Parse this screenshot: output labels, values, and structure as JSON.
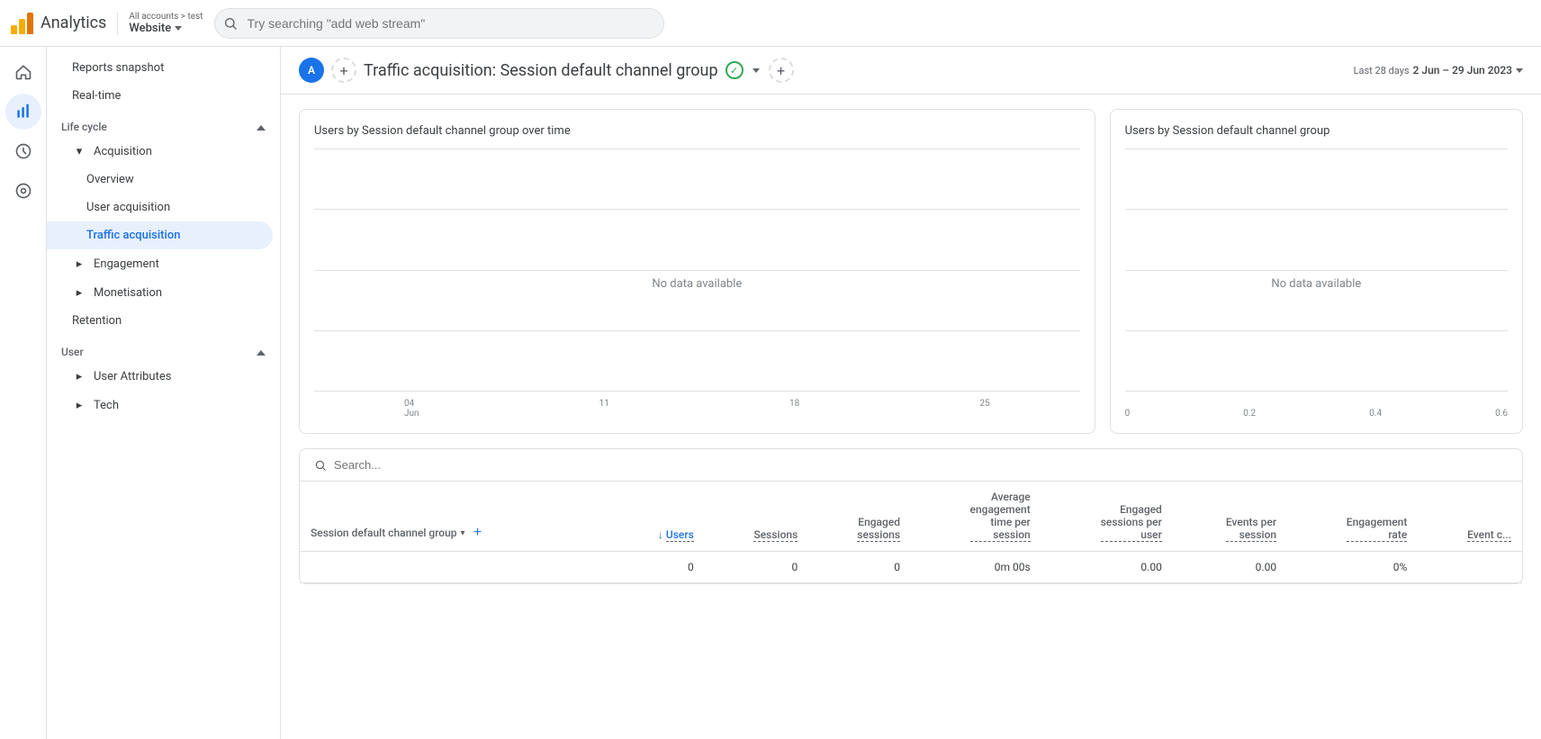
{
  "topbar": {
    "logo_alt": "Google Analytics logo",
    "app_title": "Analytics",
    "account_breadcrumb": "All accounts > test",
    "account_name": "Website",
    "search_placeholder": "Try searching \"add web stream\""
  },
  "left_nav": {
    "items": [
      {
        "id": "home",
        "icon": "house",
        "label": "Home"
      },
      {
        "id": "reports",
        "icon": "bar-chart",
        "label": "Reports",
        "active": true
      },
      {
        "id": "explore",
        "icon": "explore",
        "label": "Explore"
      },
      {
        "id": "advertising",
        "icon": "ads",
        "label": "Advertising"
      }
    ]
  },
  "sidebar": {
    "top_items": [
      {
        "id": "reports-snapshot",
        "label": "Reports snapshot",
        "indent": 0
      },
      {
        "id": "real-time",
        "label": "Real-time",
        "indent": 0
      }
    ],
    "lifecycle_section": {
      "label": "Life cycle",
      "collapsed": false,
      "items": [
        {
          "id": "acquisition",
          "label": "Acquisition",
          "indent": 1,
          "expandable": true,
          "expanded": true
        },
        {
          "id": "overview",
          "label": "Overview",
          "indent": 2
        },
        {
          "id": "user-acquisition",
          "label": "User acquisition",
          "indent": 2
        },
        {
          "id": "traffic-acquisition",
          "label": "Traffic acquisition",
          "indent": 2,
          "active": true
        },
        {
          "id": "engagement",
          "label": "Engagement",
          "indent": 1,
          "expandable": true
        },
        {
          "id": "monetisation",
          "label": "Monetisation",
          "indent": 1,
          "expandable": true
        },
        {
          "id": "retention",
          "label": "Retention",
          "indent": 1
        }
      ]
    },
    "user_section": {
      "label": "User",
      "collapsed": false,
      "items": [
        {
          "id": "user-attributes",
          "label": "User Attributes",
          "indent": 1,
          "expandable": true
        },
        {
          "id": "tech",
          "label": "Tech",
          "indent": 1,
          "expandable": true
        }
      ]
    }
  },
  "content_header": {
    "avatar_letter": "A",
    "page_title": "Traffic acquisition: Session default channel group",
    "date_label": "Last 28 days",
    "date_value": "2 Jun – 29 Jun 2023"
  },
  "charts": {
    "line_chart": {
      "title": "Users by Session default channel group over time",
      "no_data_text": "No data available",
      "x_labels": [
        "04\nJun",
        "11",
        "18",
        "25"
      ]
    },
    "donut_chart": {
      "title": "Users by Session default channel group",
      "no_data_text": "No data available",
      "y_labels": [
        "0",
        "0.2",
        "0.4",
        "0.6"
      ]
    }
  },
  "table": {
    "search_placeholder": "Search...",
    "dimension_col": {
      "label": "Session default channel group"
    },
    "columns": [
      {
        "id": "users",
        "label": "Users",
        "sorted": true,
        "sort_dir": "desc"
      },
      {
        "id": "sessions",
        "label": "Sessions"
      },
      {
        "id": "engaged-sessions",
        "label": "Engaged sessions"
      },
      {
        "id": "avg-engagement",
        "label": "Average engagement time per session"
      },
      {
        "id": "engaged-per-user",
        "label": "Engaged sessions per user"
      },
      {
        "id": "events-per-session",
        "label": "Events per session"
      },
      {
        "id": "engagement-rate",
        "label": "Engagement rate"
      },
      {
        "id": "event-count",
        "label": "Event c..."
      }
    ],
    "rows": [
      {
        "dimension": "",
        "users": "0",
        "sessions": "0",
        "engaged_sessions": "0",
        "avg_engagement": "0m 00s",
        "engaged_per_user": "0.00",
        "events_per_session": "0.00",
        "engagement_rate": "0%",
        "event_count": ""
      }
    ]
  }
}
